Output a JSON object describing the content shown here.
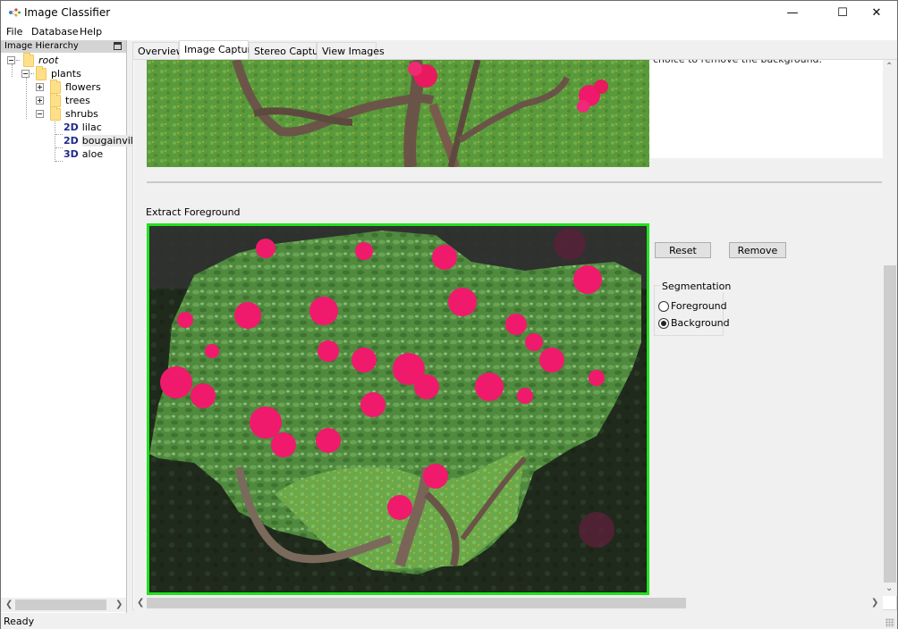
{
  "window": {
    "title": "Image Classifier",
    "controls": {
      "minimize": "—",
      "maximize": "☐",
      "close": "✕"
    }
  },
  "menu": [
    "File",
    "Database",
    "Help"
  ],
  "dock": {
    "title": "Image Hierarchy",
    "tree": [
      {
        "label": "root",
        "type": "folder",
        "expander": "minus",
        "italic": true
      },
      {
        "label": "plants",
        "type": "folder",
        "expander": "minus"
      },
      {
        "label": "flowers",
        "type": "folder",
        "expander": "plus"
      },
      {
        "label": "trees",
        "type": "folder",
        "expander": "plus"
      },
      {
        "label": "shrubs",
        "type": "folder",
        "expander": "minus"
      },
      {
        "label": "lilac",
        "type": "image",
        "badge": "2D"
      },
      {
        "label": "bougainvill",
        "type": "image",
        "badge": "2D",
        "selected": true
      },
      {
        "label": "aloe",
        "type": "image",
        "badge": "3D"
      }
    ]
  },
  "tabs": [
    {
      "label": "Overview",
      "active": false
    },
    {
      "label": "Image Capture",
      "active": true
    },
    {
      "label": "Stereo Capture",
      "active": false
    },
    {
      "label": "View Images",
      "active": false
    }
  ],
  "capture": {
    "instructions_visible": "choice to remove the background.",
    "section_label": "Extract Foreground",
    "reset_label": "Reset",
    "remove_label": "Remove",
    "segmentation": {
      "title": "Segmentation",
      "options": [
        "Foreground",
        "Background"
      ],
      "selected": "Background"
    },
    "frame_color": "#22e01e"
  },
  "scroll": {
    "vertical_position_fraction": 0.62,
    "horizontal_position_fraction": 0.0
  },
  "status": "Ready"
}
